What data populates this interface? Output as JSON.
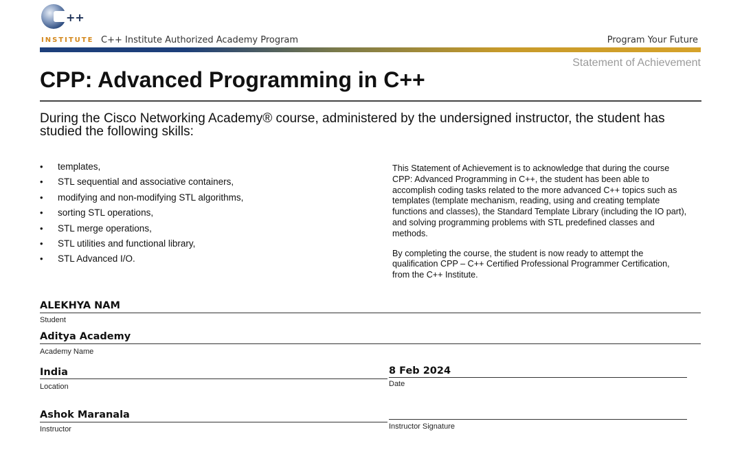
{
  "header": {
    "logo_plus": "++",
    "logo_text": "INSTITUTE",
    "program": "C++ Institute Authorized Academy Program",
    "slogan": "Program Your Future",
    "statement": "Statement of Achievement"
  },
  "course_title": "CPP: Advanced Programming in C++",
  "intro": "During the Cisco Networking Academy® course, administered by the undersigned instructor, the student has studied the following skills:",
  "skills": [
    "templates,",
    "STL sequential and associative containers,",
    "modifying and non-modifying STL algorithms,",
    "sorting STL operations,",
    "STL merge operations,",
    "STL utilities and functional library,",
    "STL Advanced I/O."
  ],
  "description": [
    "This Statement of Achievement is to acknowledge that during the course CPP: Advanced Programming in C++, the student has been able to accomplish coding tasks related to the more advanced C++ topics such as templates (template mechanism, reading, using and creating template functions and classes), the Standard Template Library (including the IO part), and solving programming problems with STL predefined classes and methods.",
    "By completing the course, the student is now ready to attempt the qualification CPP – C++ Certified Professional Programmer Certification, from the C++ Institute."
  ],
  "fields": {
    "student": {
      "value": "ALEKHYA NAM",
      "label": "Student"
    },
    "academy": {
      "value": "Aditya Academy",
      "label": "Academy Name"
    },
    "location": {
      "value": "India",
      "label": "Location"
    },
    "date": {
      "value": "8 Feb 2024",
      "label": "Date"
    },
    "instructor": {
      "value": "Ashok Maranala",
      "label": "Instructor"
    },
    "signature": {
      "value": "",
      "label": "Instructor Signature"
    }
  },
  "colors": {
    "brand_blue": "#1d3f7a",
    "brand_gold": "#d4881c",
    "statement_gray": "#9a9a9a"
  }
}
